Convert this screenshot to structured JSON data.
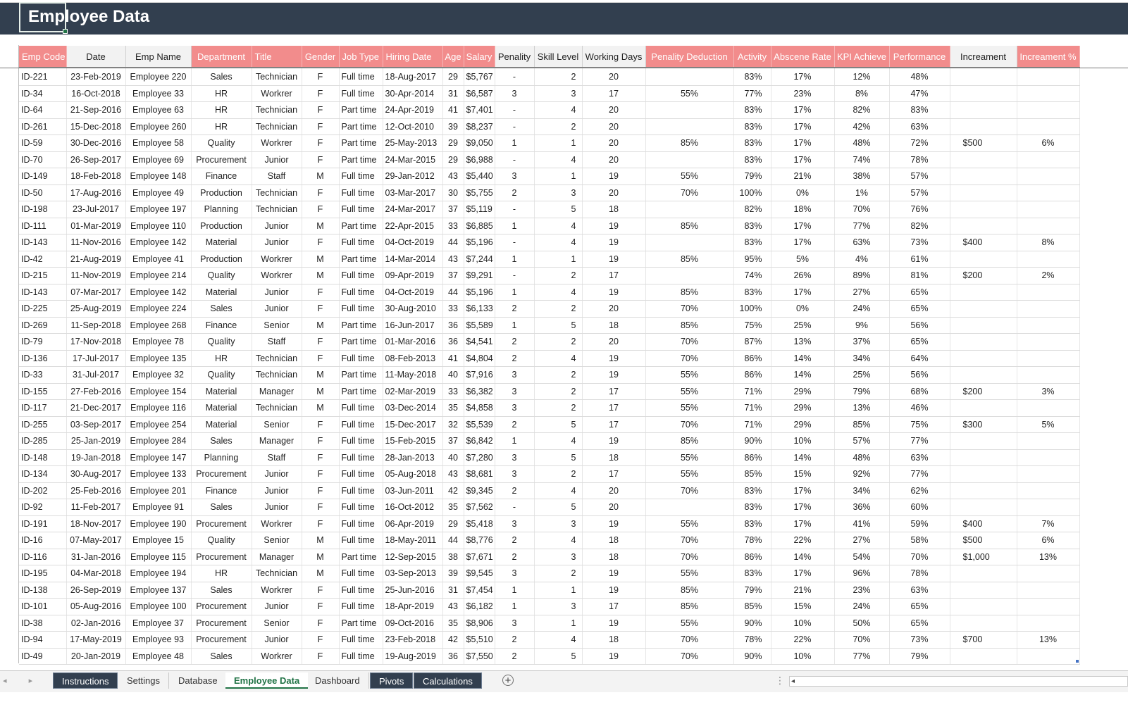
{
  "sheet_title": "Employee Data",
  "headers": [
    {
      "label": "Emp Code",
      "style": "pink"
    },
    {
      "label": "Date",
      "style": "white"
    },
    {
      "label": "Emp Name",
      "style": "white"
    },
    {
      "label": "Department",
      "style": "pink"
    },
    {
      "label": "Title",
      "style": "pink"
    },
    {
      "label": "Gender",
      "style": "pink"
    },
    {
      "label": "Job Type",
      "style": "pink"
    },
    {
      "label": "Hiring Date",
      "style": "pink"
    },
    {
      "label": "Age",
      "style": "pink"
    },
    {
      "label": "Salary",
      "style": "pink"
    },
    {
      "label": "Penality",
      "style": "white"
    },
    {
      "label": "Skill Level",
      "style": "white"
    },
    {
      "label": "Working Days",
      "style": "white"
    },
    {
      "label": "Penality Deduction",
      "style": "pink"
    },
    {
      "label": "Activity",
      "style": "pink"
    },
    {
      "label": "Abscene Rate",
      "style": "pink"
    },
    {
      "label": "KPI Achieve",
      "style": "pink"
    },
    {
      "label": "Performance",
      "style": "pink"
    },
    {
      "label": "Increament",
      "style": "white"
    },
    {
      "label": "Increament %",
      "style": "pink"
    }
  ],
  "rows": [
    [
      "ID-221",
      "23-Feb-2019",
      "Employee 220",
      "Sales",
      "Technician",
      "F",
      "Full time",
      "18-Aug-2017",
      "29",
      "$5,767",
      "-",
      "2",
      "20",
      "",
      "83%",
      "17%",
      "12%",
      "48%",
      "",
      ""
    ],
    [
      "ID-34",
      "16-Oct-2018",
      "Employee 33",
      "HR",
      "Workrer",
      "F",
      "Full time",
      "30-Apr-2014",
      "31",
      "$6,587",
      "3",
      "3",
      "17",
      "55%",
      "77%",
      "23%",
      "8%",
      "47%",
      "",
      ""
    ],
    [
      "ID-64",
      "21-Sep-2016",
      "Employee 63",
      "HR",
      "Technician",
      "F",
      "Part time",
      "24-Apr-2019",
      "41",
      "$7,401",
      "-",
      "4",
      "20",
      "",
      "83%",
      "17%",
      "82%",
      "83%",
      "",
      ""
    ],
    [
      "ID-261",
      "15-Dec-2018",
      "Employee 260",
      "HR",
      "Technician",
      "F",
      "Part time",
      "12-Oct-2010",
      "39",
      "$8,237",
      "-",
      "2",
      "20",
      "",
      "83%",
      "17%",
      "42%",
      "63%",
      "",
      ""
    ],
    [
      "ID-59",
      "30-Dec-2016",
      "Employee 58",
      "Quality",
      "Workrer",
      "F",
      "Part time",
      "25-May-2013",
      "29",
      "$9,050",
      "1",
      "1",
      "20",
      "85%",
      "83%",
      "17%",
      "48%",
      "72%",
      "$500",
      "6%"
    ],
    [
      "ID-70",
      "26-Sep-2017",
      "Employee 69",
      "Procurement",
      "Junior",
      "F",
      "Part time",
      "24-Mar-2015",
      "29",
      "$6,988",
      "-",
      "4",
      "20",
      "",
      "83%",
      "17%",
      "74%",
      "78%",
      "",
      ""
    ],
    [
      "ID-149",
      "18-Feb-2018",
      "Employee 148",
      "Finance",
      "Staff",
      "M",
      "Full time",
      "29-Jan-2012",
      "43",
      "$5,440",
      "3",
      "1",
      "19",
      "55%",
      "79%",
      "21%",
      "38%",
      "57%",
      "",
      ""
    ],
    [
      "ID-50",
      "17-Aug-2016",
      "Employee 49",
      "Production",
      "Technician",
      "F",
      "Full time",
      "03-Mar-2017",
      "30",
      "$5,755",
      "2",
      "3",
      "20",
      "70%",
      "100%",
      "0%",
      "1%",
      "57%",
      "",
      ""
    ],
    [
      "ID-198",
      "23-Jul-2017",
      "Employee 197",
      "Planning",
      "Technician",
      "F",
      "Full time",
      "24-Mar-2017",
      "37",
      "$5,119",
      "-",
      "5",
      "18",
      "",
      "82%",
      "18%",
      "70%",
      "76%",
      "",
      ""
    ],
    [
      "ID-111",
      "01-Mar-2019",
      "Employee 110",
      "Production",
      "Junior",
      "M",
      "Part time",
      "22-Apr-2015",
      "33",
      "$6,885",
      "1",
      "4",
      "19",
      "85%",
      "83%",
      "17%",
      "77%",
      "82%",
      "",
      ""
    ],
    [
      "ID-143",
      "11-Nov-2016",
      "Employee 142",
      "Material",
      "Junior",
      "F",
      "Full time",
      "04-Oct-2019",
      "44",
      "$5,196",
      "-",
      "4",
      "19",
      "",
      "83%",
      "17%",
      "63%",
      "73%",
      "$400",
      "8%"
    ],
    [
      "ID-42",
      "21-Aug-2019",
      "Employee 41",
      "Production",
      "Workrer",
      "M",
      "Part time",
      "14-Mar-2014",
      "43",
      "$7,244",
      "1",
      "1",
      "19",
      "85%",
      "95%",
      "5%",
      "4%",
      "61%",
      "",
      ""
    ],
    [
      "ID-215",
      "11-Nov-2019",
      "Employee 214",
      "Quality",
      "Workrer",
      "M",
      "Full time",
      "09-Apr-2019",
      "37",
      "$9,291",
      "-",
      "2",
      "17",
      "",
      "74%",
      "26%",
      "89%",
      "81%",
      "$200",
      "2%"
    ],
    [
      "ID-143",
      "07-Mar-2017",
      "Employee 142",
      "Material",
      "Junior",
      "F",
      "Full time",
      "04-Oct-2019",
      "44",
      "$5,196",
      "1",
      "4",
      "19",
      "85%",
      "83%",
      "17%",
      "27%",
      "65%",
      "",
      ""
    ],
    [
      "ID-225",
      "25-Aug-2019",
      "Employee 224",
      "Sales",
      "Junior",
      "F",
      "Full time",
      "30-Aug-2010",
      "33",
      "$6,133",
      "2",
      "2",
      "20",
      "70%",
      "100%",
      "0%",
      "24%",
      "65%",
      "",
      ""
    ],
    [
      "ID-269",
      "11-Sep-2018",
      "Employee 268",
      "Finance",
      "Senior",
      "M",
      "Part time",
      "16-Jun-2017",
      "36",
      "$5,589",
      "1",
      "5",
      "18",
      "85%",
      "75%",
      "25%",
      "9%",
      "56%",
      "",
      ""
    ],
    [
      "ID-79",
      "17-Nov-2018",
      "Employee 78",
      "Quality",
      "Staff",
      "F",
      "Part time",
      "01-Mar-2016",
      "36",
      "$4,541",
      "2",
      "2",
      "20",
      "70%",
      "87%",
      "13%",
      "37%",
      "65%",
      "",
      ""
    ],
    [
      "ID-136",
      "17-Jul-2017",
      "Employee 135",
      "HR",
      "Technician",
      "F",
      "Full time",
      "08-Feb-2013",
      "41",
      "$4,804",
      "2",
      "4",
      "19",
      "70%",
      "86%",
      "14%",
      "34%",
      "64%",
      "",
      ""
    ],
    [
      "ID-33",
      "31-Jul-2017",
      "Employee 32",
      "Quality",
      "Technician",
      "M",
      "Part time",
      "11-May-2018",
      "40",
      "$7,916",
      "3",
      "2",
      "19",
      "55%",
      "86%",
      "14%",
      "25%",
      "56%",
      "",
      ""
    ],
    [
      "ID-155",
      "27-Feb-2016",
      "Employee 154",
      "Material",
      "Manager",
      "M",
      "Part time",
      "02-Mar-2019",
      "33",
      "$6,382",
      "3",
      "2",
      "17",
      "55%",
      "71%",
      "29%",
      "79%",
      "68%",
      "$200",
      "3%"
    ],
    [
      "ID-117",
      "21-Dec-2017",
      "Employee 116",
      "Material",
      "Technician",
      "M",
      "Full time",
      "03-Dec-2014",
      "35",
      "$4,858",
      "3",
      "2",
      "17",
      "55%",
      "71%",
      "29%",
      "13%",
      "46%",
      "",
      ""
    ],
    [
      "ID-255",
      "03-Sep-2017",
      "Employee 254",
      "Material",
      "Senior",
      "F",
      "Full time",
      "15-Dec-2017",
      "32",
      "$5,539",
      "2",
      "5",
      "17",
      "70%",
      "71%",
      "29%",
      "85%",
      "75%",
      "$300",
      "5%"
    ],
    [
      "ID-285",
      "25-Jan-2019",
      "Employee 284",
      "Sales",
      "Manager",
      "F",
      "Full time",
      "15-Feb-2015",
      "37",
      "$6,842",
      "1",
      "4",
      "19",
      "85%",
      "90%",
      "10%",
      "57%",
      "77%",
      "",
      ""
    ],
    [
      "ID-148",
      "19-Jan-2018",
      "Employee 147",
      "Planning",
      "Staff",
      "F",
      "Full time",
      "28-Jan-2013",
      "40",
      "$7,280",
      "3",
      "5",
      "18",
      "55%",
      "86%",
      "14%",
      "48%",
      "63%",
      "",
      ""
    ],
    [
      "ID-134",
      "30-Aug-2017",
      "Employee 133",
      "Procurement",
      "Junior",
      "F",
      "Full time",
      "05-Aug-2018",
      "43",
      "$8,681",
      "3",
      "2",
      "17",
      "55%",
      "85%",
      "15%",
      "92%",
      "77%",
      "",
      ""
    ],
    [
      "ID-202",
      "25-Feb-2016",
      "Employee 201",
      "Finance",
      "Junior",
      "F",
      "Full time",
      "03-Jun-2011",
      "42",
      "$9,345",
      "2",
      "4",
      "20",
      "70%",
      "83%",
      "17%",
      "34%",
      "62%",
      "",
      ""
    ],
    [
      "ID-92",
      "11-Feb-2017",
      "Employee 91",
      "Sales",
      "Junior",
      "F",
      "Full time",
      "16-Oct-2012",
      "35",
      "$7,562",
      "-",
      "5",
      "20",
      "",
      "83%",
      "17%",
      "36%",
      "60%",
      "",
      ""
    ],
    [
      "ID-191",
      "18-Nov-2017",
      "Employee 190",
      "Procurement",
      "Workrer",
      "F",
      "Full time",
      "06-Apr-2019",
      "29",
      "$5,418",
      "3",
      "3",
      "19",
      "55%",
      "83%",
      "17%",
      "41%",
      "59%",
      "$400",
      "7%"
    ],
    [
      "ID-16",
      "07-May-2017",
      "Employee 15",
      "Quality",
      "Senior",
      "M",
      "Full time",
      "18-May-2011",
      "44",
      "$8,776",
      "2",
      "4",
      "18",
      "70%",
      "78%",
      "22%",
      "27%",
      "58%",
      "$500",
      "6%"
    ],
    [
      "ID-116",
      "31-Jan-2016",
      "Employee 115",
      "Procurement",
      "Manager",
      "M",
      "Part time",
      "12-Sep-2015",
      "38",
      "$7,671",
      "2",
      "3",
      "18",
      "70%",
      "86%",
      "14%",
      "54%",
      "70%",
      "$1,000",
      "13%"
    ],
    [
      "ID-195",
      "04-Mar-2018",
      "Employee 194",
      "HR",
      "Technician",
      "M",
      "Full time",
      "03-Sep-2013",
      "39",
      "$9,545",
      "3",
      "2",
      "19",
      "55%",
      "83%",
      "17%",
      "96%",
      "78%",
      "",
      ""
    ],
    [
      "ID-138",
      "26-Sep-2019",
      "Employee 137",
      "Sales",
      "Workrer",
      "F",
      "Full time",
      "25-Jun-2016",
      "31",
      "$7,454",
      "1",
      "1",
      "19",
      "85%",
      "79%",
      "21%",
      "23%",
      "63%",
      "",
      ""
    ],
    [
      "ID-101",
      "05-Aug-2016",
      "Employee 100",
      "Procurement",
      "Junior",
      "F",
      "Full time",
      "18-Apr-2019",
      "43",
      "$6,182",
      "1",
      "3",
      "17",
      "85%",
      "85%",
      "15%",
      "24%",
      "65%",
      "",
      ""
    ],
    [
      "ID-38",
      "02-Jan-2016",
      "Employee 37",
      "Procurement",
      "Senior",
      "F",
      "Part time",
      "09-Oct-2016",
      "35",
      "$8,906",
      "3",
      "1",
      "19",
      "55%",
      "90%",
      "10%",
      "50%",
      "65%",
      "",
      ""
    ],
    [
      "ID-94",
      "17-May-2019",
      "Employee 93",
      "Procurement",
      "Junior",
      "F",
      "Full time",
      "23-Feb-2018",
      "42",
      "$5,510",
      "2",
      "4",
      "18",
      "70%",
      "78%",
      "22%",
      "70%",
      "73%",
      "$700",
      "13%"
    ],
    [
      "ID-49",
      "20-Jan-2019",
      "Employee 48",
      "Sales",
      "Workrer",
      "F",
      "Full time",
      "19-Aug-2019",
      "36",
      "$7,550",
      "2",
      "5",
      "19",
      "70%",
      "90%",
      "10%",
      "77%",
      "79%",
      "",
      ""
    ]
  ],
  "sheet_tabs": [
    {
      "label": "Instructions",
      "style": "dark"
    },
    {
      "label": "Settings",
      "style": "plain"
    },
    {
      "label": "Database",
      "style": "plain"
    },
    {
      "label": "Employee Data",
      "style": "active"
    },
    {
      "label": "Dashboard",
      "style": "plain"
    },
    {
      "label": "Pivots",
      "style": "dark"
    },
    {
      "label": "Calculations",
      "style": "dark"
    }
  ],
  "icons": {
    "nav_arrows": "◂ ▸",
    "add_sheet": "+",
    "split_handle": "⋮",
    "scroll_left": "◂"
  },
  "colors": {
    "banner": "#323f4f",
    "header_pink": "#f28c8c",
    "active_tab_text": "#217346"
  }
}
